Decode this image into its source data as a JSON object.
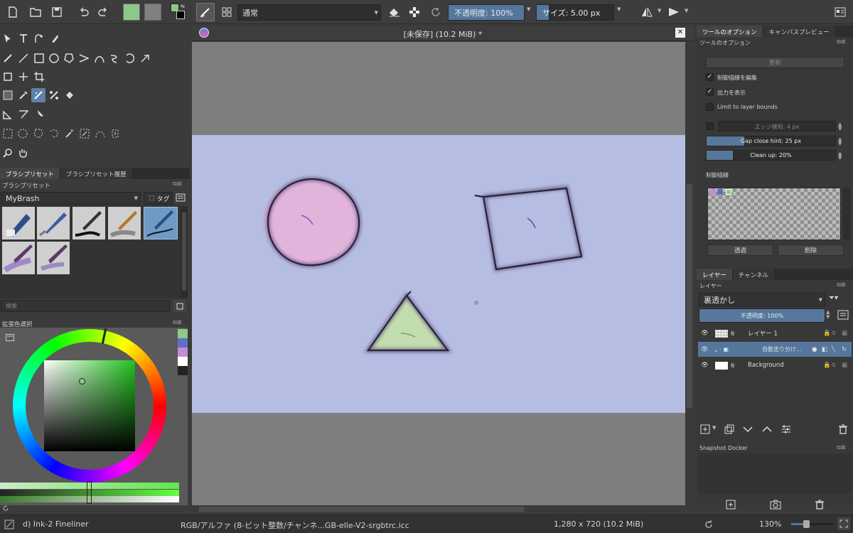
{
  "toolbar": {
    "blend_mode": "通常",
    "opacity_label": "不透明度: 100%",
    "opacity_value": 1.0,
    "size_label": "サイズ: 5.00 px",
    "size_fill": 0.12,
    "colors": {
      "fg": "#8fc98a",
      "bg": "#808080"
    }
  },
  "brush_presets": {
    "tabs": [
      "ブラシプリセット",
      "ブラシプリセット履歴"
    ],
    "title": "ブラシプリセット",
    "preset_name": "MyBrash",
    "tag_label": "タグ",
    "search_placeholder": "検索"
  },
  "color_selector": {
    "title": "拡張色選択",
    "recent_colors": [
      "#8fc98a",
      "#5f6fc8",
      "#c68bd6",
      "#ffffff",
      "#222222"
    ]
  },
  "document": {
    "title": "[未保存]  (10.2 MiB) *"
  },
  "tool_options": {
    "tabs": [
      "ツールのオプション",
      "キャンバスプレビュー"
    ],
    "title": "ツールのオプション",
    "update_button": "更新",
    "checkboxes": [
      {
        "label": "制御描線を編集",
        "checked": true
      },
      {
        "label": "出力を表示",
        "checked": true
      },
      {
        "label": "Limit to layer bounds",
        "checked": false
      }
    ],
    "edge_detect": "エッジ検知: 4 px",
    "gap_close": "Gap close hint: 25 px",
    "gap_close_fill": 0.25,
    "clean_up": "Clean up: 20%",
    "clean_up_fill": 0.2,
    "control_lines_title": "制御描線",
    "palette_swatches": [
      "#c68bd6",
      "#5f6fc8",
      "#8fc98a"
    ],
    "transparent_button": "透過",
    "delete_button": "削除"
  },
  "layers": {
    "tabs": [
      "レイヤー",
      "チャンネル"
    ],
    "title": "レイヤー",
    "blend_mode": "裏透かし",
    "opacity_label": "不透明度: 100%",
    "items": [
      {
        "name": "レイヤー 1",
        "selected": false
      },
      {
        "name": "自動塗り分け...",
        "selected": true
      },
      {
        "name": "Background",
        "selected": false
      }
    ]
  },
  "snapshot": {
    "title": "Snapshot Docker"
  },
  "status": {
    "brush": "d) Ink-2 Fineliner",
    "color_space": "RGB/アルファ (8-ビット整数/チャンネ...GB-elle-V2-srgbtrc.icc",
    "dimensions": "1,280 x 720 (10.2 MiB)",
    "zoom": "130%"
  }
}
